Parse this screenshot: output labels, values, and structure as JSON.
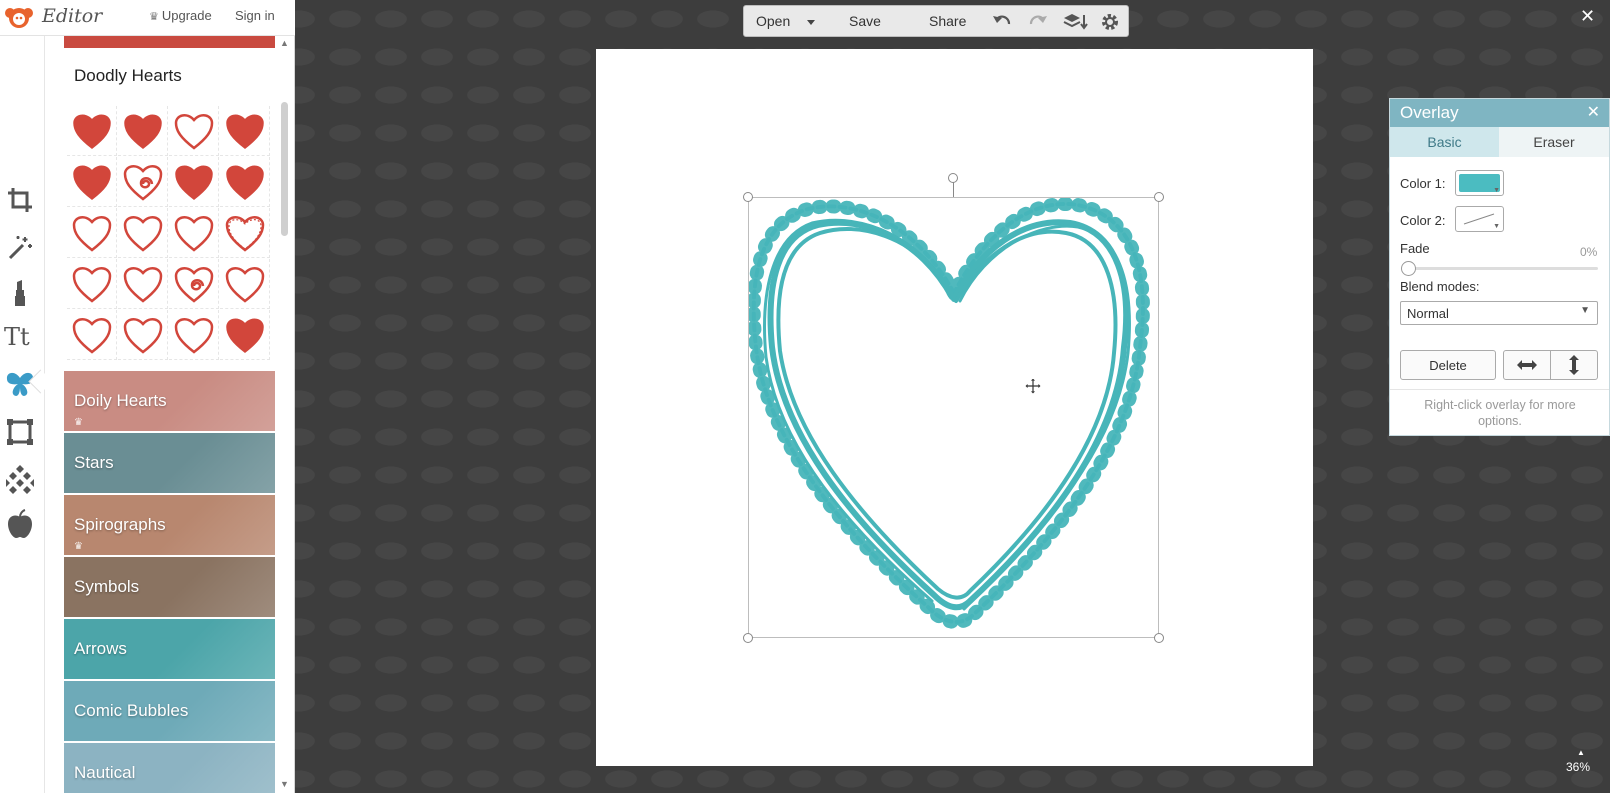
{
  "app": {
    "logo_text": "Editor",
    "upgrade_label": "Upgrade",
    "signin_label": "Sign in"
  },
  "tool_rail": [
    "crop-icon",
    "magic-wand-icon",
    "lipstick-icon",
    "text-icon",
    "butterfly-icon",
    "frame-icon",
    "texture-icon",
    "apple-icon"
  ],
  "panel": {
    "section_title": "Doodly Hearts",
    "heart_thumbnails": 20,
    "categories": [
      {
        "label": "Doily Hearts",
        "premium": true,
        "color": "#c98c83"
      },
      {
        "label": "Stars",
        "premium": false,
        "color": "#6a8e94"
      },
      {
        "label": "Spirographs",
        "premium": true,
        "color": "#b8876f"
      },
      {
        "label": "Symbols",
        "premium": false,
        "color": "#8a7361"
      },
      {
        "label": "Arrows",
        "premium": false,
        "color": "#4ca5a9"
      },
      {
        "label": "Comic Bubbles",
        "premium": false,
        "color": "#6eaab8"
      },
      {
        "label": "Nautical",
        "premium": false,
        "color": "#8cb3c2"
      }
    ]
  },
  "toolbar": {
    "open_label": "Open",
    "save_label": "Save",
    "share_label": "Share"
  },
  "overlay_panel": {
    "title": "Overlay",
    "tab_basic": "Basic",
    "tab_eraser": "Eraser",
    "color1_label": "Color 1:",
    "color1_value": "#4bbcc1",
    "color2_label": "Color 2:",
    "fade_label": "Fade",
    "fade_value": "0%",
    "blend_label": "Blend modes:",
    "blend_value": "Normal",
    "delete_label": "Delete",
    "hint": "Right-click overlay for more options."
  },
  "zoom_level": "36%",
  "colors": {
    "accent": "#7fb5c2",
    "heart_red": "#d2463b",
    "overlay_teal": "#47b5b9"
  }
}
